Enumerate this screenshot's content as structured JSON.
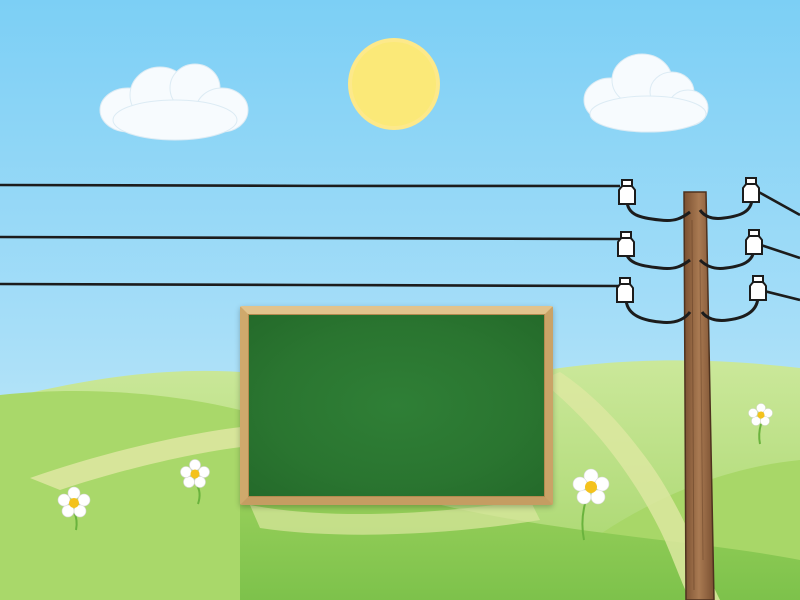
{
  "scene": {
    "sky_top": "#7fd0f6",
    "sky_bottom": "#cbeefb",
    "sun_color": "#fbeb7d",
    "grass_light": "#a9d868",
    "grass_dark": "#7cc24a",
    "path_color": "#dfe7a0",
    "wire_color": "#1a1a1a",
    "pole_color": "#9a6a45",
    "board_frame": "#d9b77e",
    "board_surface": "#2a7530"
  },
  "board": {
    "text": ""
  },
  "icons": [
    "sun-icon",
    "cloud-icon",
    "flower-icon",
    "insulator-icon",
    "utility-pole-icon"
  ]
}
